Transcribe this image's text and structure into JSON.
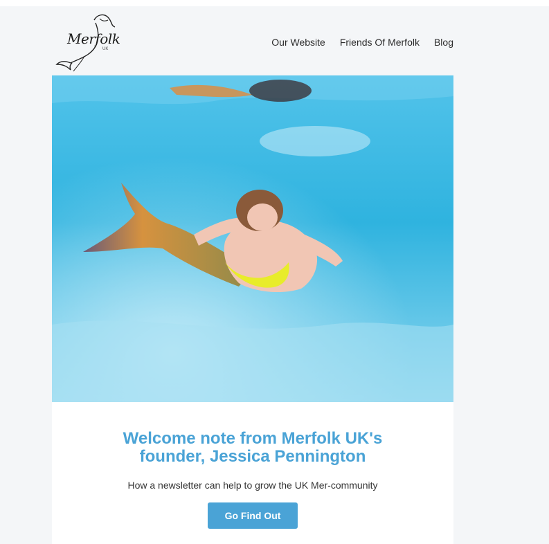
{
  "logo": {
    "text": "Merfolk",
    "subtext": "UK"
  },
  "nav": {
    "items": [
      "Our Website",
      "Friends Of Merfolk",
      "Blog"
    ]
  },
  "hero": {
    "colors": {
      "water": "#3cb8e0",
      "water_light": "#7fd2ee",
      "tail": "#c88a45",
      "top": "#ffd23f"
    }
  },
  "content": {
    "title": "Welcome note from Merfolk UK's\nfounder, Jessica Pennington",
    "subtitle": "How a newsletter can help to grow the UK Mer-community",
    "cta_label": "Go Find Out"
  },
  "colors": {
    "accent": "#4aa3d6",
    "background": "#f4f6f8"
  }
}
